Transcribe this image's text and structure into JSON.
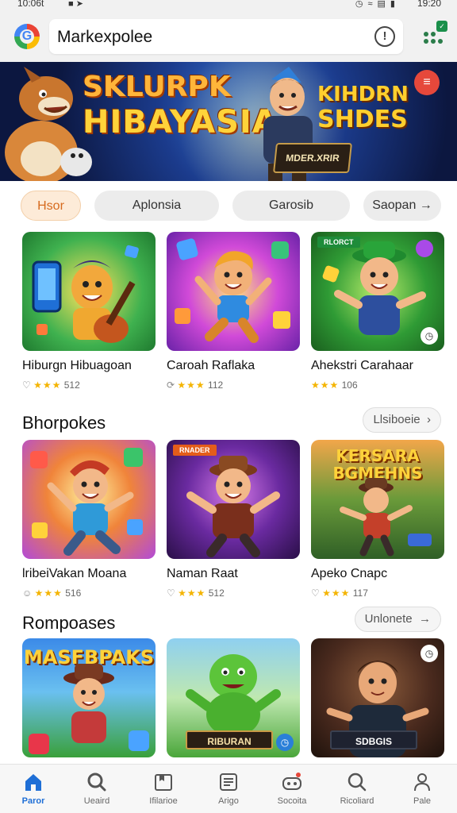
{
  "status": {
    "time_left": "10:06t",
    "time_right": "19:20"
  },
  "search": {
    "query": "Markexpolee"
  },
  "banner": {
    "title_line1": "SKLURPK",
    "title_line2": "HIBAYASIA",
    "side_line1": "KIHDRN",
    "side_line2": "SHDES",
    "laptop_label": "MDER.XRIR"
  },
  "chips": [
    "Hsor",
    "Aplonsia",
    "Garosib",
    "Saopan"
  ],
  "row1": [
    {
      "name": "Hiburgn Hibuagoan",
      "rating": "512",
      "bg": "#2fae4e"
    },
    {
      "name": "Caroah Raflaka",
      "rating": "112",
      "bg": "#b43ed0"
    },
    {
      "name": "Ahekstri Carahaar",
      "rating": "106",
      "bg": "#2f8b2c",
      "tag": "RLORCT"
    }
  ],
  "section2": {
    "title": "Bhorpokes",
    "see_all": "Llsiboeie"
  },
  "row2": [
    {
      "name": "lribeiVakan Moana",
      "rating": "516",
      "bg": "#e46b2a"
    },
    {
      "name": "Naman Raat",
      "rating": "512",
      "bg": "#5b2a86",
      "tag": "RNADER"
    },
    {
      "name": "Apeko Cnapc",
      "rating": "117",
      "bg": "#2b7d3f",
      "title1": "KERSARA",
      "title2": "BGMEHNS"
    }
  ],
  "section3": {
    "title": "Rompoases",
    "see_all": "Unlonete"
  },
  "row3": [
    {
      "title1": "MASFBPAKS",
      "bg": "#2f7bd8"
    },
    {
      "label": "RIBURAN",
      "bg": "#4aa63a"
    },
    {
      "label": "SDBGIS",
      "bg": "#4b2a1e"
    }
  ],
  "nav": [
    "Paror",
    "Ueaird",
    "Ifilarioe",
    "Arigo",
    "Socoita",
    "Ricoliard",
    "Pale"
  ]
}
